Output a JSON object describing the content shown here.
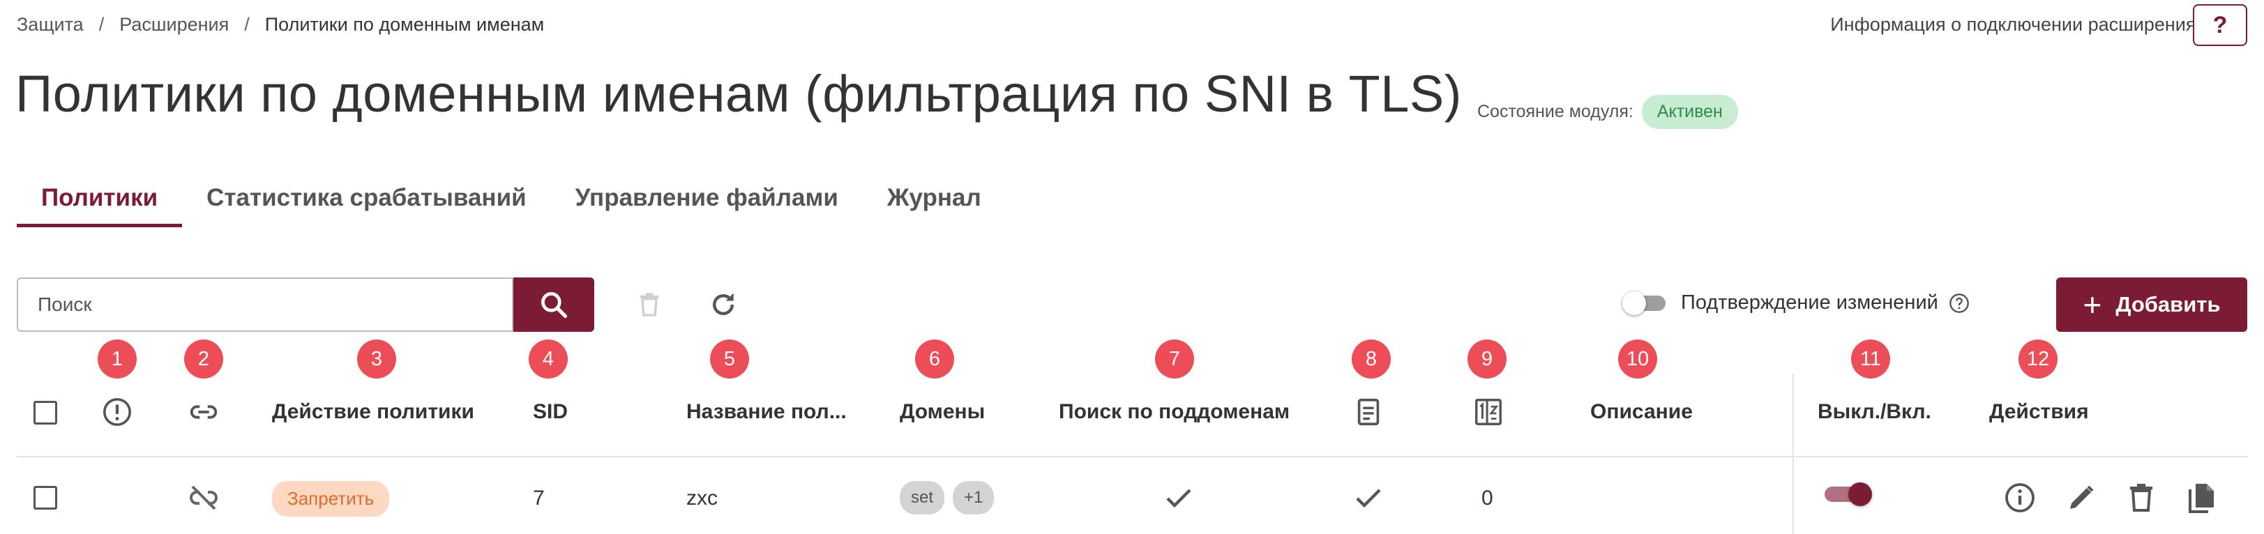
{
  "breadcrumb": {
    "items": [
      "Защита",
      "Расширения"
    ],
    "current": "Политики по доменным именам",
    "separator": "/"
  },
  "connection_info": {
    "label": "Информация о подключении расширения:",
    "help_label": "?"
  },
  "page": {
    "title": "Политики по доменным именам (фильтрация по SNI в TLS)",
    "module_state_label": "Состояние модуля:",
    "module_state_value": "Активен"
  },
  "tabs": [
    {
      "label": "Политики",
      "active": true
    },
    {
      "label": "Статистика срабатываний",
      "active": false
    },
    {
      "label": "Управление файлами",
      "active": false
    },
    {
      "label": "Журнал",
      "active": false
    }
  ],
  "toolbar": {
    "search_placeholder": "Поиск",
    "search_icon": "search-icon",
    "delete_icon": "trash-icon",
    "refresh_icon": "refresh-icon",
    "confirm_changes_label": "Подтверждение изменений",
    "confirm_changes_enabled": false,
    "add_label": "Добавить"
  },
  "table": {
    "column_numbers": [
      "1",
      "2",
      "3",
      "4",
      "5",
      "6",
      "7",
      "8",
      "9",
      "10",
      "11",
      "12"
    ],
    "headers": {
      "col1_icon": "alert-circle-icon",
      "col2_icon": "link-icon",
      "col3": "Действие политики",
      "col4": "SID",
      "col5": "Название пол...",
      "col6": "Домены",
      "col7": "Поиск по поддоменам",
      "col8_icon": "document-icon",
      "col9_icon": "counter-icon",
      "col10": "Описание",
      "col11": "Выкл./Вкл.",
      "col12": "Действия"
    },
    "rows": [
      {
        "link_icon": "link-off-icon",
        "action": "Запретить",
        "sid": "7",
        "name": "zxc",
        "domains": [
          "set",
          "+1"
        ],
        "subdomain_search": true,
        "col8_checked": true,
        "count": "0",
        "description": "",
        "enabled": true,
        "actions": [
          "info-icon",
          "edit-icon",
          "trash-icon",
          "copy-icon"
        ]
      }
    ]
  },
  "colors": {
    "primary": "#7b1c33",
    "badge_number": "#ec4d57",
    "active_badge_bg": "#c8ecd2",
    "active_badge_text": "#2e8b4a",
    "deny_bg": "#fdd9c2",
    "deny_text": "#e06b2b"
  }
}
